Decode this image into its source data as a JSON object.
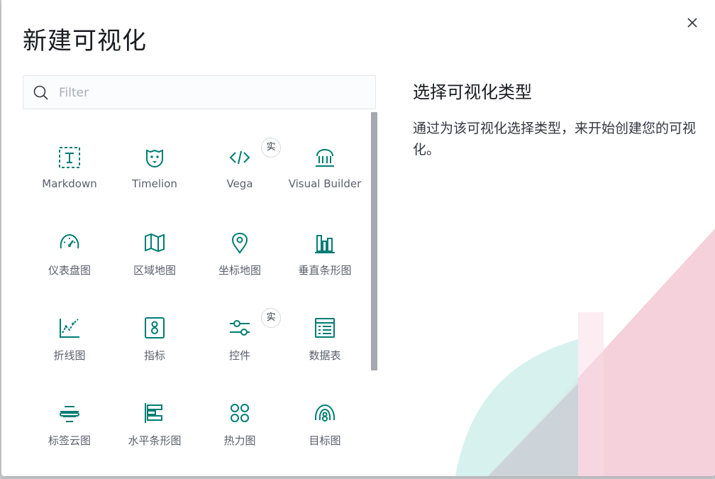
{
  "modal": {
    "title": "新建可视化",
    "close_icon": "close-icon"
  },
  "search": {
    "placeholder": "Filter",
    "value": "",
    "icon": "search-icon"
  },
  "grid": {
    "items": [
      {
        "label": "Markdown",
        "icon": "markdown-icon",
        "badge": ""
      },
      {
        "label": "Timelion",
        "icon": "timelion-icon",
        "badge": ""
      },
      {
        "label": "Vega",
        "icon": "code-icon",
        "badge": "实"
      },
      {
        "label": "Visual Builder",
        "icon": "visual-builder-icon",
        "badge": ""
      },
      {
        "label": "仪表盘图",
        "icon": "gauge-icon",
        "badge": ""
      },
      {
        "label": "区域地图",
        "icon": "map-icon",
        "badge": ""
      },
      {
        "label": "坐标地图",
        "icon": "map-pin-icon",
        "badge": ""
      },
      {
        "label": "垂直条形图",
        "icon": "vertical-bar-icon",
        "badge": ""
      },
      {
        "label": "折线图",
        "icon": "line-chart-icon",
        "badge": ""
      },
      {
        "label": "指标",
        "icon": "metric-icon",
        "badge": ""
      },
      {
        "label": "控件",
        "icon": "controls-icon",
        "badge": "实"
      },
      {
        "label": "数据表",
        "icon": "table-icon",
        "badge": ""
      },
      {
        "label": "标签云图",
        "icon": "tag-cloud-icon",
        "badge": ""
      },
      {
        "label": "水平条形图",
        "icon": "horizontal-bar-icon",
        "badge": ""
      },
      {
        "label": "热力图",
        "icon": "heatmap-icon",
        "badge": ""
      },
      {
        "label": "目标图",
        "icon": "goal-icon",
        "badge": ""
      }
    ]
  },
  "side": {
    "title": "选择可视化类型",
    "description": "通过为该可视化选择类型，来开始创建您的可视化。"
  },
  "colors": {
    "icon": "#017d73",
    "decor_teal": "#cbeeea",
    "decor_pink": "#f1c6d4"
  }
}
